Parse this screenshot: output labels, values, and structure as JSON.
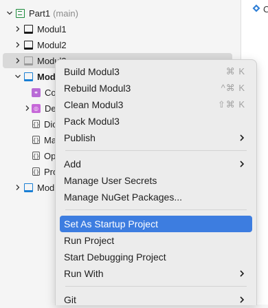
{
  "tree": {
    "solution": {
      "name": "Part1",
      "branch": "(main)"
    },
    "items": [
      {
        "label": "Modul1"
      },
      {
        "label": "Modul2"
      },
      {
        "label": "Modul3"
      },
      {
        "label": "Modul"
      },
      {
        "label": "Co"
      },
      {
        "label": "Dep"
      },
      {
        "label": "Dic"
      },
      {
        "label": "Ma"
      },
      {
        "label": "Op"
      },
      {
        "label": "Pro"
      },
      {
        "label": "Modu"
      }
    ]
  },
  "editor": {
    "tab_label": "C"
  },
  "menu": {
    "build": {
      "label": "Build Modul3",
      "shortcut": "⌘ K"
    },
    "rebuild": {
      "label": "Rebuild Modul3",
      "shortcut": "^⌘ K"
    },
    "clean": {
      "label": "Clean Modul3",
      "shortcut": "⇧⌘ K"
    },
    "pack": {
      "label": "Pack Modul3"
    },
    "publish": {
      "label": "Publish"
    },
    "add": {
      "label": "Add"
    },
    "user_secrets": {
      "label": "Manage User Secrets"
    },
    "nuget": {
      "label": "Manage NuGet Packages..."
    },
    "startup": {
      "label": "Set As Startup Project"
    },
    "run": {
      "label": "Run Project"
    },
    "debug": {
      "label": "Start Debugging Project"
    },
    "run_with": {
      "label": "Run With"
    },
    "git": {
      "label": "Git"
    }
  },
  "colors": {
    "highlight": "#3d7de0",
    "project_blue": "#1a7fd4",
    "solution_green": "#1a8a3a"
  }
}
